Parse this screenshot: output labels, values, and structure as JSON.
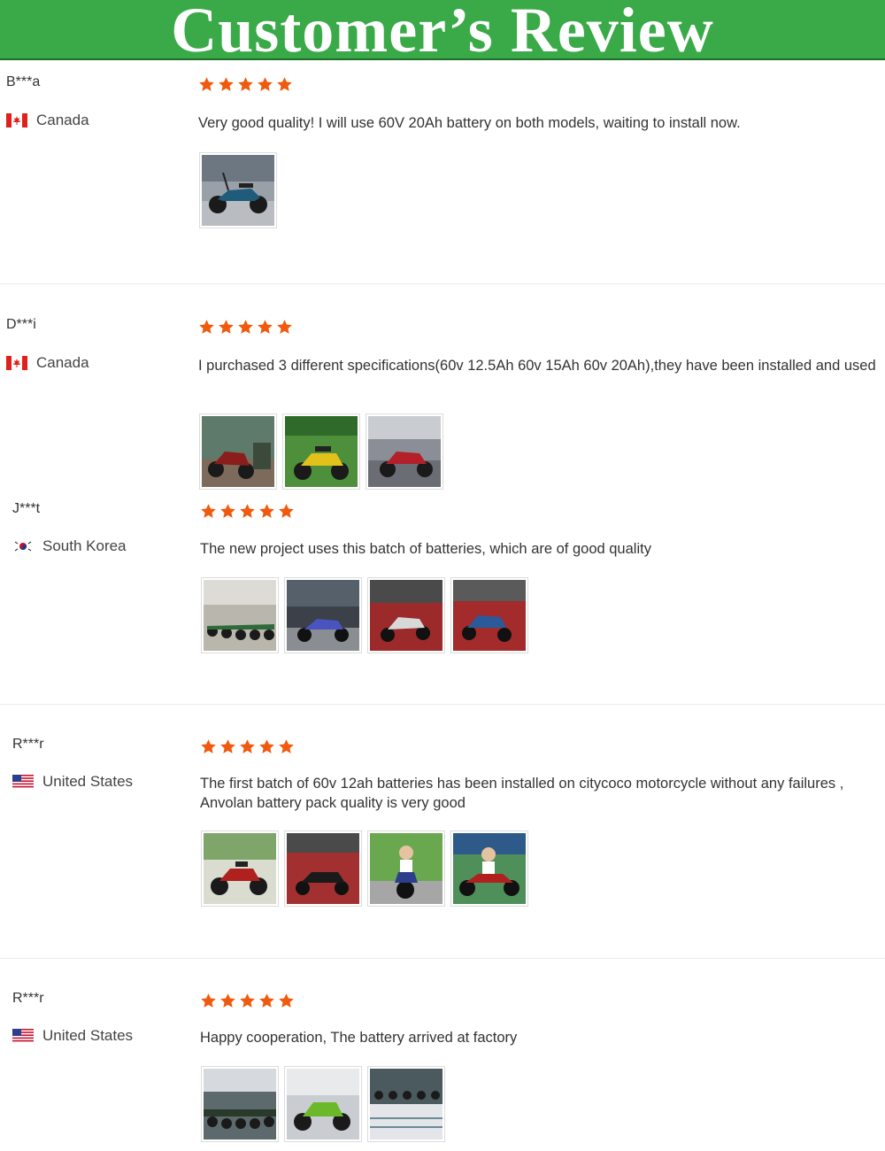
{
  "banner": {
    "title": "Customer’s Review"
  },
  "colors": {
    "banner": "#3aaa48",
    "star": "#f05a0e"
  },
  "reviews": [
    {
      "name": "B***a",
      "country": "Canada",
      "flag": "canada-flag-icon",
      "rating": 5,
      "comment": "Very good quality! I will use 60V 20Ah battery on both models, waiting to install now.",
      "photo_count": 1
    },
    {
      "name": "D***i",
      "country": "Canada",
      "flag": "canada-flag-icon",
      "rating": 5,
      "comment": "I purchased 3 different specifications(60v 12.5Ah 60v 15Ah 60v 20Ah),they have been installed and used",
      "photo_count": 3
    },
    {
      "name": "J***t",
      "country": "South Korea",
      "flag": "south-korea-flag-icon",
      "rating": 5,
      "comment": "The new project uses this batch of batteries, which are of good quality",
      "photo_count": 4
    },
    {
      "name": "R***r",
      "country": "United States",
      "flag": "us-flag-icon",
      "rating": 5,
      "comment": "The first batch of 60v 12ah batteries has been installed on citycoco motorcycle without any failures , Anvolan battery pack quality is very good",
      "photo_count": 4
    },
    {
      "name": "R***r",
      "country": "United States",
      "flag": "us-flag-icon",
      "rating": 5,
      "comment": "Happy cooperation, The battery arrived at factory",
      "photo_count": 3
    }
  ]
}
